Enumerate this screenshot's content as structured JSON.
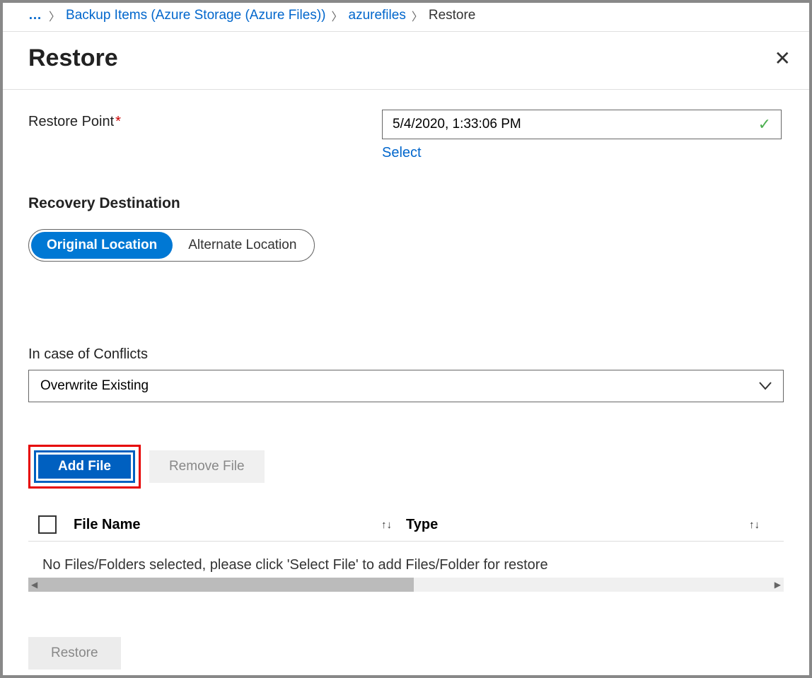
{
  "breadcrumb": {
    "ellipsis": "…",
    "item1": "Backup Items (Azure Storage (Azure Files))",
    "item2": "azurefiles",
    "current": "Restore"
  },
  "header": {
    "title": "Restore"
  },
  "restorePoint": {
    "label": "Restore Point",
    "value": "5/4/2020, 1:33:06 PM",
    "selectLink": "Select"
  },
  "recoveryDestination": {
    "label": "Recovery Destination",
    "options": {
      "original": "Original Location",
      "alternate": "Alternate Location"
    }
  },
  "conflicts": {
    "label": "In case of Conflicts",
    "value": "Overwrite Existing"
  },
  "buttons": {
    "addFile": "Add File",
    "removeFile": "Remove File",
    "restore": "Restore"
  },
  "table": {
    "col1": "File Name",
    "col2": "Type",
    "emptyMessage": "No Files/Folders selected, please click 'Select File' to add Files/Folder for restore"
  }
}
